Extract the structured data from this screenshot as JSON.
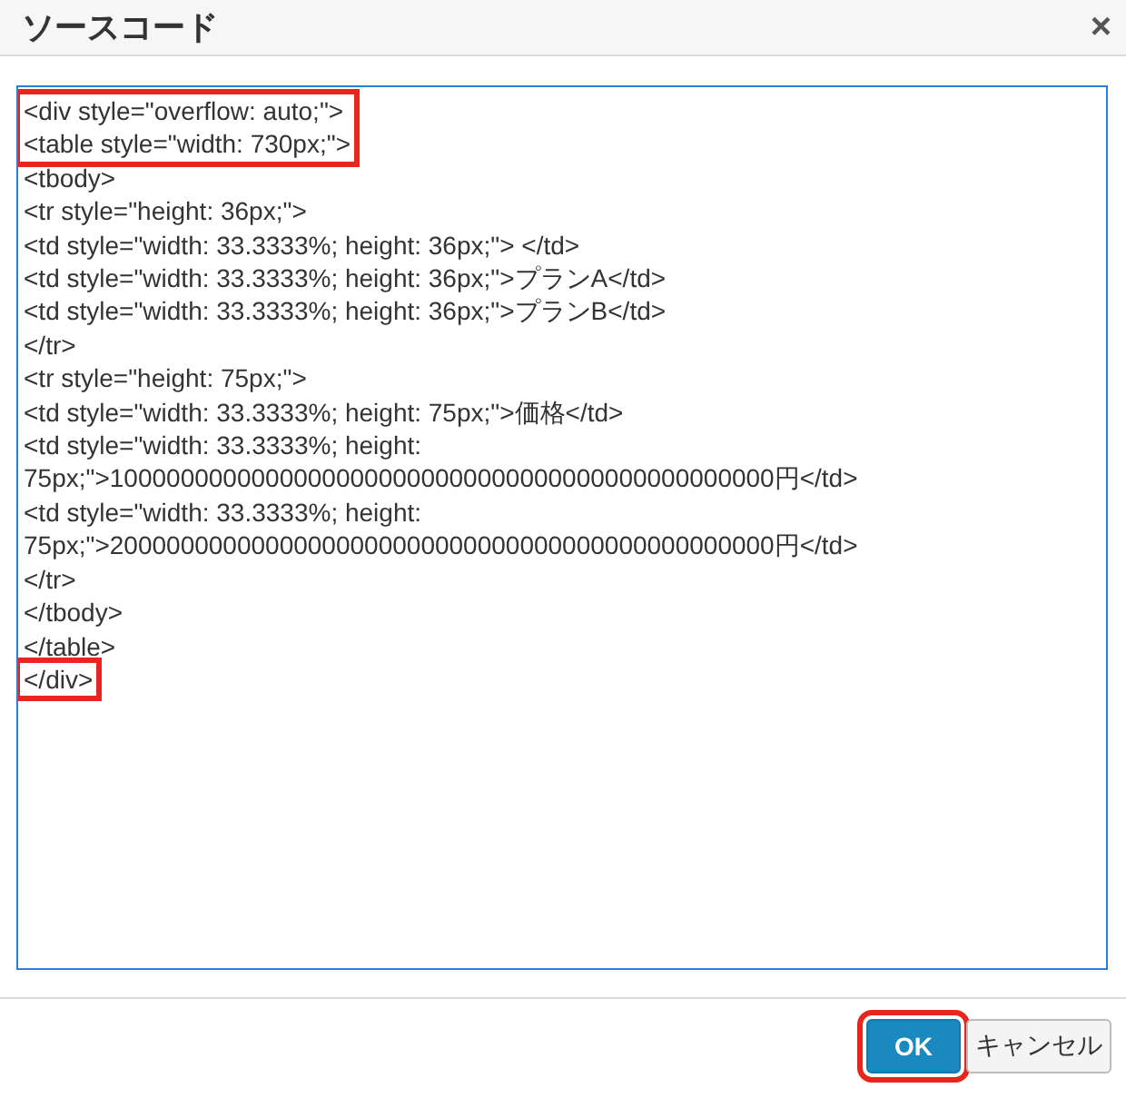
{
  "dialog": {
    "title": "ソースコード",
    "close": "×"
  },
  "source_field": {
    "blocks": [
      {
        "highlighted": true,
        "lines": [
          "<div style=\"overflow: auto;\">",
          "<table style=\"width: 730px;\">"
        ]
      },
      {
        "highlighted": false,
        "lines": [
          "<tbody>",
          "<tr style=\"height: 36px;\">",
          "<td style=\"width: 33.3333%; height: 36px;\"> </td>",
          "<td style=\"width: 33.3333%; height: 36px;\">プランA</td>",
          "<td style=\"width: 33.3333%; height: 36px;\">プランB</td>",
          "</tr>",
          "<tr style=\"height: 75px;\">",
          "<td style=\"width: 33.3333%; height: 75px;\">価格</td>",
          "<td style=\"width: 33.3333%; height:",
          "75px;\">10000000000000000000000000000000000000000000000円</td>",
          "<td style=\"width: 33.3333%; height:",
          "75px;\">20000000000000000000000000000000000000000000000円</td>",
          "</tr>",
          "</tbody>",
          "</table>"
        ]
      },
      {
        "highlighted": true,
        "lines": [
          "</div>"
        ]
      }
    ]
  },
  "buttons": [
    {
      "label": "OK",
      "kind": "primary",
      "highlighted": true
    },
    {
      "label": "キャンセル",
      "kind": "secondary",
      "highlighted": false
    }
  ]
}
